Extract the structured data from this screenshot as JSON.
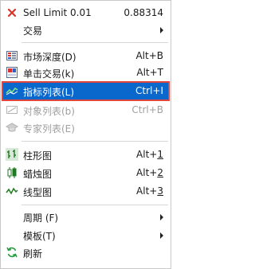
{
  "menu": {
    "sell_limit": {
      "label": "Sell Limit 0.01",
      "value": "0.88314",
      "icon": "close-x-icon"
    },
    "trade": {
      "label": "交易"
    },
    "market_depth": {
      "label": "市场深度(D)",
      "shortcut": "Alt+B",
      "icon": "depth-of-market-icon"
    },
    "one_click": {
      "label": "单击交易(k)",
      "shortcut": "Alt+T",
      "icon": "one-click-trading-icon"
    },
    "indicators": {
      "label": "指标列表(L)",
      "shortcut": "Ctrl+I",
      "icon": "indicators-list-icon"
    },
    "objects": {
      "label": "对象列表(b)",
      "shortcut": "Ctrl+B",
      "icon": "objects-list-icon"
    },
    "experts": {
      "label": "专家列表(E)",
      "icon": "expert-hat-icon"
    },
    "bar_chart": {
      "label": "柱形图",
      "shortcut_prefix": "Alt+",
      "shortcut_key": "1",
      "icon": "bar-chart-icon"
    },
    "candles": {
      "label": "蜡烛图",
      "shortcut_prefix": "Alt+",
      "shortcut_key": "2",
      "icon": "candlestick-icon"
    },
    "line_chart": {
      "label": "线型图",
      "shortcut_prefix": "Alt+",
      "shortcut_key": "3",
      "icon": "line-chart-icon"
    },
    "period": {
      "label": "周期 (F)"
    },
    "template": {
      "label": "模板(T)"
    },
    "refresh": {
      "label": "刷新",
      "icon": "refresh-icon"
    }
  },
  "colors": {
    "highlight": "#0a67cc",
    "focus_border": "#e0463c",
    "disabled": "#a0a0a0"
  }
}
